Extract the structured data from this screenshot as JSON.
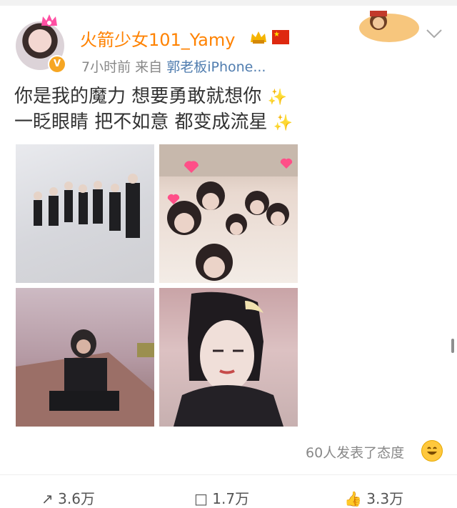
{
  "post": {
    "username": "火箭少女101_Yamy",
    "time": "7小时前",
    "source_prefix": "来自",
    "source_name": "郭老板iPhone...",
    "line1": "你是我的魔力 想要勇敢就想你",
    "line2": "一眨眼睛 把不如意 都变成流星"
  },
  "reactions": {
    "text": "60人发表了态度"
  },
  "actions": [
    {
      "icon": "share-icon",
      "label": "3.6万"
    },
    {
      "icon": "comment-icon",
      "label": "1.7万"
    },
    {
      "icon": "like-icon",
      "label": "3.3万"
    }
  ],
  "colors": {
    "username": "#ff8200",
    "source_link": "#507daf",
    "meta": "#888888"
  }
}
